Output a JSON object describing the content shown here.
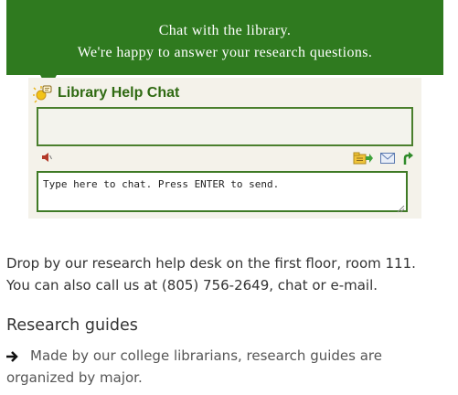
{
  "banner": {
    "line1": "Chat with the library.",
    "line2": "We're happy to answer your research questions."
  },
  "chat": {
    "title": "Library Help Chat",
    "input_placeholder": "Type here to chat. Press ENTER to send.",
    "icons": {
      "logo": "chat-logo-icon",
      "sound": "speaker-icon",
      "transfer": "folder-transfer-icon",
      "email": "envelope-icon",
      "popout": "popout-arrow-icon"
    }
  },
  "help": {
    "line1": "Drop by our research help desk on the first floor, room 111.",
    "line2": "You can also call us at (805) 756-2649, chat or e-mail."
  },
  "guides": {
    "heading": "Research guides",
    "description": "Made by our college librarians, research guides are organized by major."
  },
  "colors": {
    "banner_bg": "#2f7a1f",
    "chat_bg": "#f4f2ea",
    "title_green": "#2f6a12",
    "border_green": "#3f7a25"
  }
}
